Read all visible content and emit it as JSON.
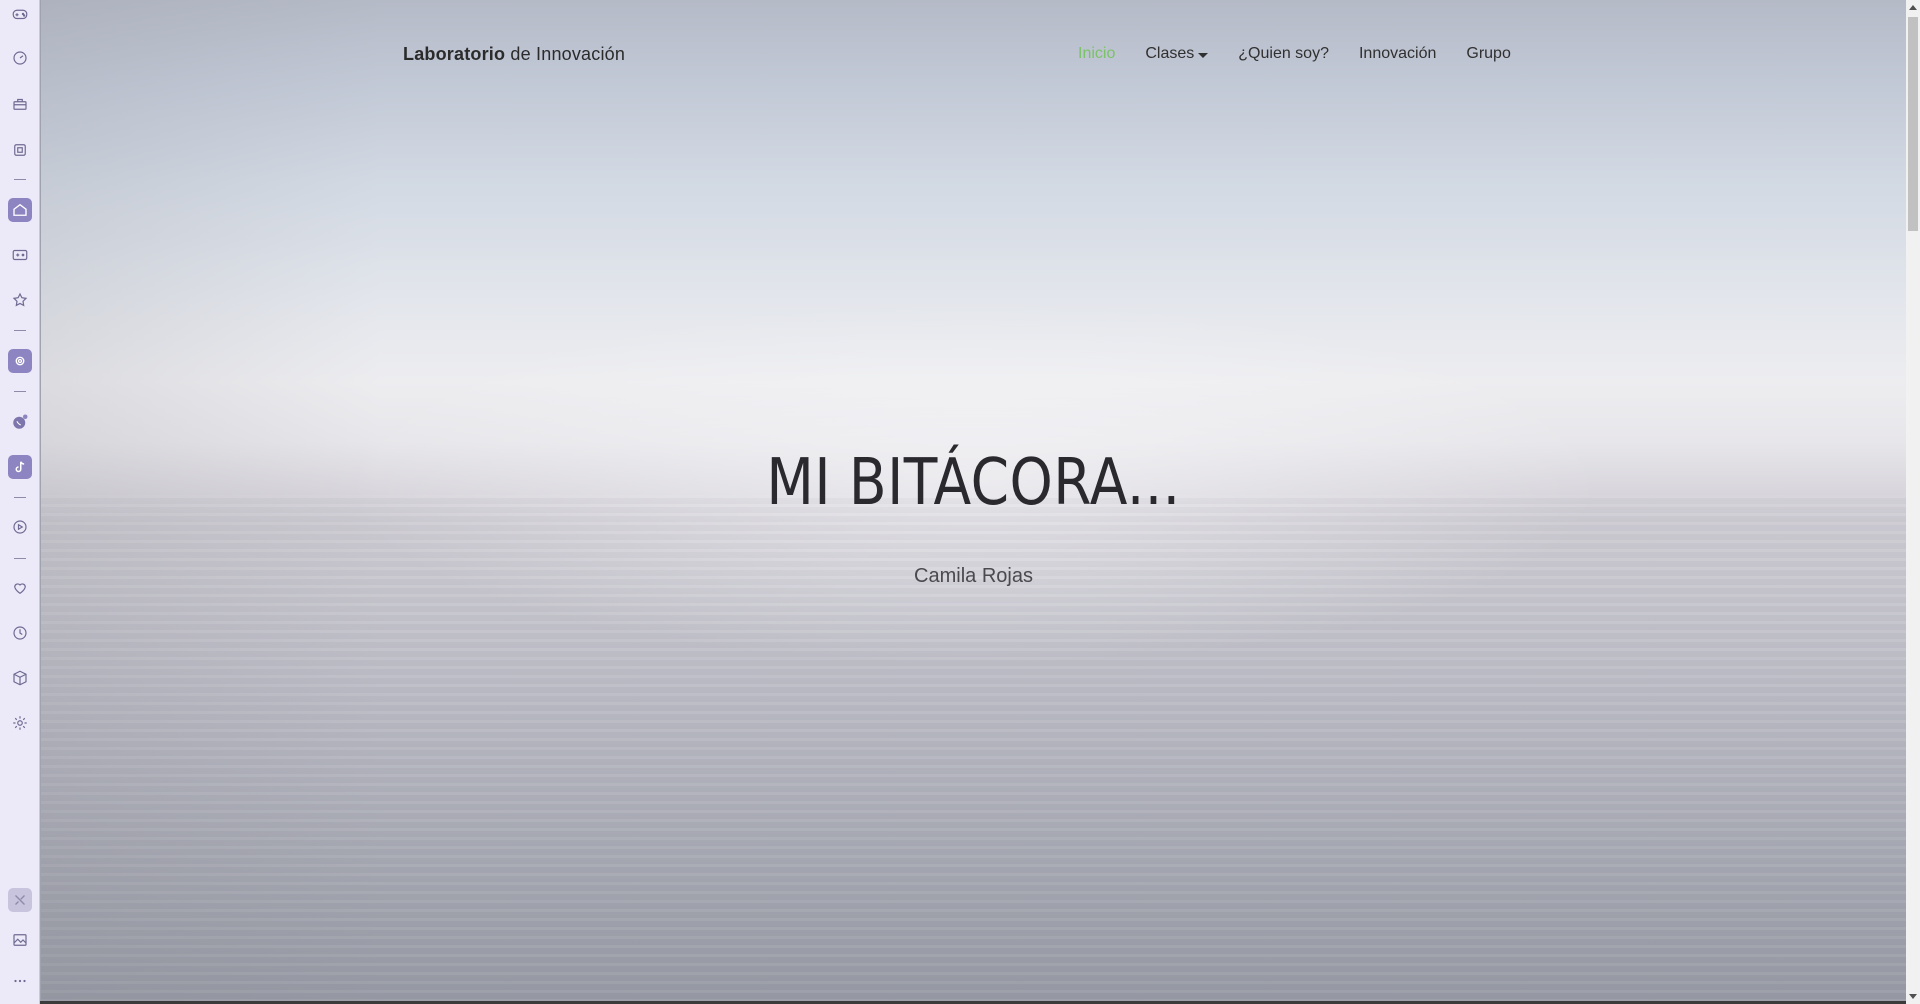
{
  "sidebar": {
    "icons": [
      {
        "name": "gamepad-icon"
      },
      {
        "name": "speedometer-icon"
      },
      {
        "name": "briefcase-icon"
      },
      {
        "name": "chip-icon"
      },
      {
        "name": "home-icon"
      },
      {
        "name": "game-controller-icon"
      },
      {
        "name": "star-icon"
      },
      {
        "name": "settings-badge-icon"
      },
      {
        "name": "whatsapp-icon"
      },
      {
        "name": "tiktok-icon"
      },
      {
        "name": "play-icon"
      },
      {
        "name": "heart-icon"
      },
      {
        "name": "clock-icon"
      },
      {
        "name": "cube-icon"
      },
      {
        "name": "gear-icon"
      },
      {
        "name": "tools-icon"
      },
      {
        "name": "gallery-icon"
      },
      {
        "name": "more-icon"
      }
    ],
    "accent": "#8d84c2"
  },
  "navbar": {
    "brand_bold": "Laboratorio",
    "brand_rest": " de Innovación",
    "items": [
      {
        "label": "Inicio",
        "active": true
      },
      {
        "label": "Clases",
        "dropdown": true
      },
      {
        "label": "¿Quien soy?"
      },
      {
        "label": "Innovación"
      },
      {
        "label": "Grupo"
      }
    ],
    "active_color": "#7bc26a"
  },
  "hero": {
    "title": "MI BITÁCORA...",
    "subtitle": "Camila Rojas"
  }
}
